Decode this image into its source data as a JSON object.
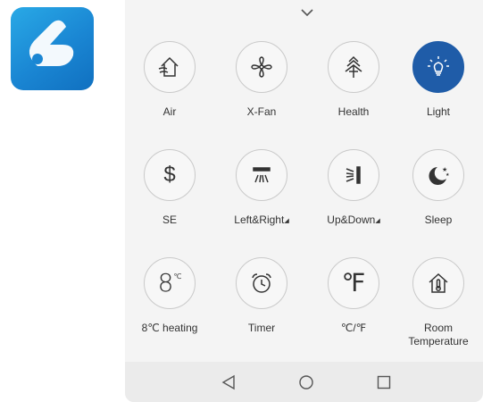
{
  "app_icon": {
    "icon": "app-logo-icon",
    "color": "#1a86d3"
  },
  "panel": {
    "collapse_icon": "chevron-down-icon",
    "active_color": "#1f5ca8",
    "tiles": [
      {
        "id": "air",
        "label": "Air",
        "icon": "house-wind-icon",
        "active": false
      },
      {
        "id": "x-fan",
        "label": "X-Fan",
        "icon": "fan-icon",
        "active": false
      },
      {
        "id": "health",
        "label": "Health",
        "icon": "tree-icon",
        "active": false
      },
      {
        "id": "light",
        "label": "Light",
        "icon": "light-bulb-icon",
        "active": true
      },
      {
        "id": "se",
        "label": "SE",
        "icon": "dollar-icon",
        "glyph": "$",
        "active": false
      },
      {
        "id": "left-right",
        "label": "Left&Right",
        "icon": "horizontal-swing-icon",
        "active": false,
        "dropdown": "◢"
      },
      {
        "id": "up-down",
        "label": "Up&Down",
        "icon": "vertical-swing-icon",
        "active": false,
        "dropdown": "◢"
      },
      {
        "id": "sleep",
        "label": "Sleep",
        "icon": "moon-stars-icon",
        "active": false
      },
      {
        "id": "heating",
        "label": "8℃ heating",
        "icon": "eight-degree-icon",
        "glyph": "8",
        "glyph_sup": "℃",
        "active": false
      },
      {
        "id": "timer",
        "label": "Timer",
        "icon": "alarm-clock-icon",
        "active": false
      },
      {
        "id": "unit",
        "label": "℃/℉",
        "icon": "fahrenheit-icon",
        "glyph": "℉",
        "active": false
      },
      {
        "id": "room-temp",
        "label_line1": "Room",
        "label_line2": "Temperature",
        "icon": "house-thermometer-icon",
        "active": false
      }
    ]
  },
  "navbar": {
    "back_icon": "back-triangle-icon",
    "home_icon": "home-circle-icon",
    "recents_icon": "recents-square-icon"
  }
}
